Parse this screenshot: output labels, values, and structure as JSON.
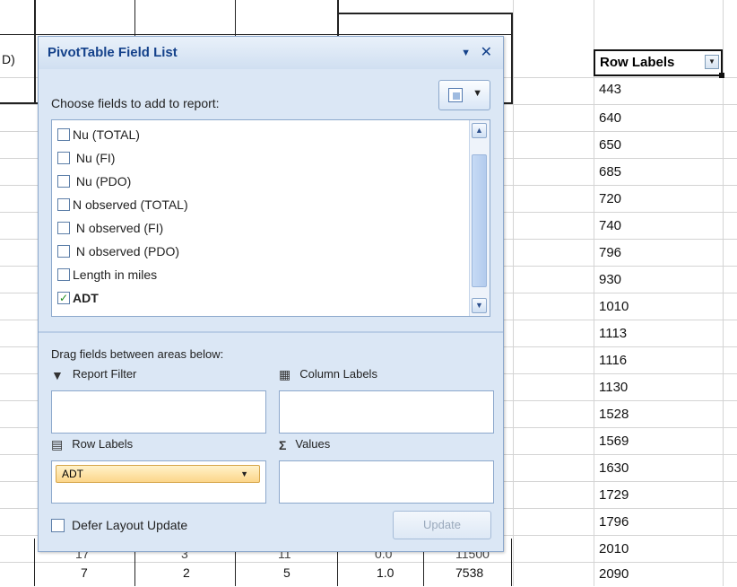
{
  "sheet": {
    "partial_header": "D)",
    "bottom_row": [
      "7",
      "2",
      "5",
      "1.0",
      "7538"
    ],
    "partial_row": [
      "17",
      "3",
      "11",
      "0.0",
      "11500"
    ]
  },
  "row_labels": {
    "header": "Row Labels",
    "values": [
      "443",
      "640",
      "650",
      "685",
      "720",
      "740",
      "796",
      "930",
      "1010",
      "1113",
      "1116",
      "1130",
      "1528",
      "1569",
      "1630",
      "1729",
      "1796",
      "2010",
      "2090"
    ]
  },
  "panel": {
    "title": "PivotTable Field List",
    "title_dropdown_icon": "▼",
    "close_icon": "✕",
    "choose_label": "Choose fields to add to report:",
    "fields": [
      {
        "label": "Nu (TOTAL)",
        "checked": false
      },
      {
        "label": "Nu (FI)",
        "checked": false
      },
      {
        "label": "Nu (PDO)",
        "checked": false
      },
      {
        "label": "N observed (TOTAL)",
        "checked": false
      },
      {
        "label": "N observed (FI)",
        "checked": false
      },
      {
        "label": "N observed (PDO)",
        "checked": false
      },
      {
        "label": "Length in miles",
        "checked": false
      },
      {
        "label": "ADT",
        "checked": true
      }
    ],
    "drag_label": "Drag fields between areas below:",
    "report_filter_label": "Report Filter",
    "column_labels_label": "Column Labels",
    "row_labels_label": "Row Labels",
    "values_label": "Values",
    "row_labels_item": "ADT",
    "defer_label": "Defer Layout Update",
    "update_label": "Update"
  }
}
